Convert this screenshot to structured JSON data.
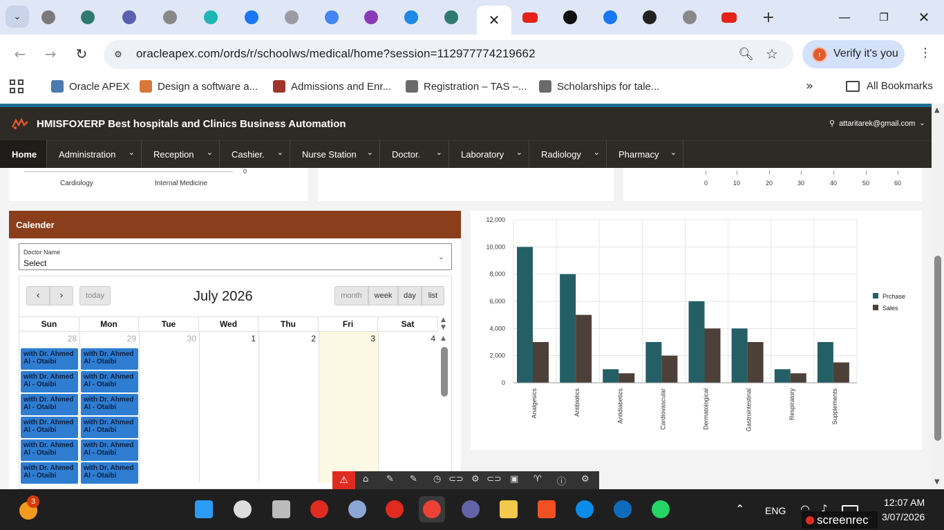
{
  "browser": {
    "active_tab_close": "✕",
    "tabs_icons": [
      "tab-search-icon",
      "globe-icon",
      "image-icon",
      "ring-icon",
      "gemini-icon",
      "facebook-icon",
      "chart-icon",
      "sparkle-icon",
      "stack-icon",
      "cloud-icon",
      "image-icon",
      "youtube-icon",
      "z-icon",
      "facebook-icon",
      "lock-icon",
      "globe-icon",
      "youtube-icon"
    ],
    "new_tab": "+",
    "url": "oracleapex.com/ords/r/schoolws/medical/home?session=112977774219662",
    "verify_label": "Verify it's you",
    "bookmarks": [
      {
        "label": "Oracle APEX",
        "color": "#4a7bb0"
      },
      {
        "label": "Design a software a...",
        "color": "#d9773a"
      },
      {
        "label": "Admissions and Enr...",
        "color": "#a0342c"
      },
      {
        "label": "Registration – TAS –...",
        "color": "#6a6a6a"
      },
      {
        "label": "Scholarships for tale...",
        "color": "#6a6a6a"
      }
    ],
    "all_bookmarks": "All Bookmarks"
  },
  "app": {
    "title": "HMISFOXERP Best hospitals and Clinics Business Automation",
    "user": "attaritarek@gmail.com",
    "nav": [
      {
        "label": "Home",
        "dropdown": false
      },
      {
        "label": "Administration",
        "dropdown": true
      },
      {
        "label": "Reception",
        "dropdown": true
      },
      {
        "label": "Cashier.",
        "dropdown": true
      },
      {
        "label": "Nurse Station",
        "dropdown": true
      },
      {
        "label": "Doctor.",
        "dropdown": true
      },
      {
        "label": "Laboratory",
        "dropdown": true
      },
      {
        "label": "Radiology",
        "dropdown": true
      },
      {
        "label": "Pharmacy",
        "dropdown": true
      }
    ]
  },
  "top_left_chart": {
    "labels": [
      "Cardiology",
      "Internal Medicine"
    ],
    "zero": "0"
  },
  "top_right_chart": {
    "ticks": [
      "0",
      "10",
      "20",
      "30",
      "40",
      "50",
      "60"
    ]
  },
  "calendar": {
    "title": "Calender",
    "doctor_label": "Doctor Name",
    "doctor_value": "Select",
    "today": "today",
    "month_title": "July 2026",
    "views": [
      "month",
      "week",
      "day",
      "list"
    ],
    "days": [
      "Sun",
      "Mon",
      "Tue",
      "Wed",
      "Thu",
      "Fri",
      "Sat"
    ],
    "dates": [
      "28",
      "29",
      "30",
      "1",
      "2",
      "3",
      "4"
    ],
    "event_label": "with Dr. Ahmed Al - Otaibi",
    "event_count_per_day": 6
  },
  "chart_data": {
    "type": "bar",
    "categories": [
      "Analgesics",
      "Antibiotics",
      "Antidiabetics",
      "Cardiovascular",
      "Dermatological",
      "Gastrointestinal",
      "Respiratory",
      "Supplements"
    ],
    "series": [
      {
        "name": "Prchase",
        "color": "#245f66",
        "values": [
          10000,
          8000,
          1000,
          3000,
          6000,
          4000,
          1000,
          3000
        ]
      },
      {
        "name": "Sales",
        "color": "#4d4039",
        "values": [
          3000,
          5000,
          700,
          2000,
          4000,
          3000,
          700,
          1500
        ]
      }
    ],
    "yticks": [
      "0",
      "2,000",
      "4,000",
      "6,000",
      "8,000",
      "10,000",
      "12,000"
    ],
    "ylim": [
      0,
      12000
    ],
    "grid": true,
    "legend": "right"
  },
  "taskbar": {
    "notif_count": "3",
    "lang": "ENG",
    "time": "12:07 AM",
    "date": "3/07/2026",
    "watermark": "screenrec"
  }
}
